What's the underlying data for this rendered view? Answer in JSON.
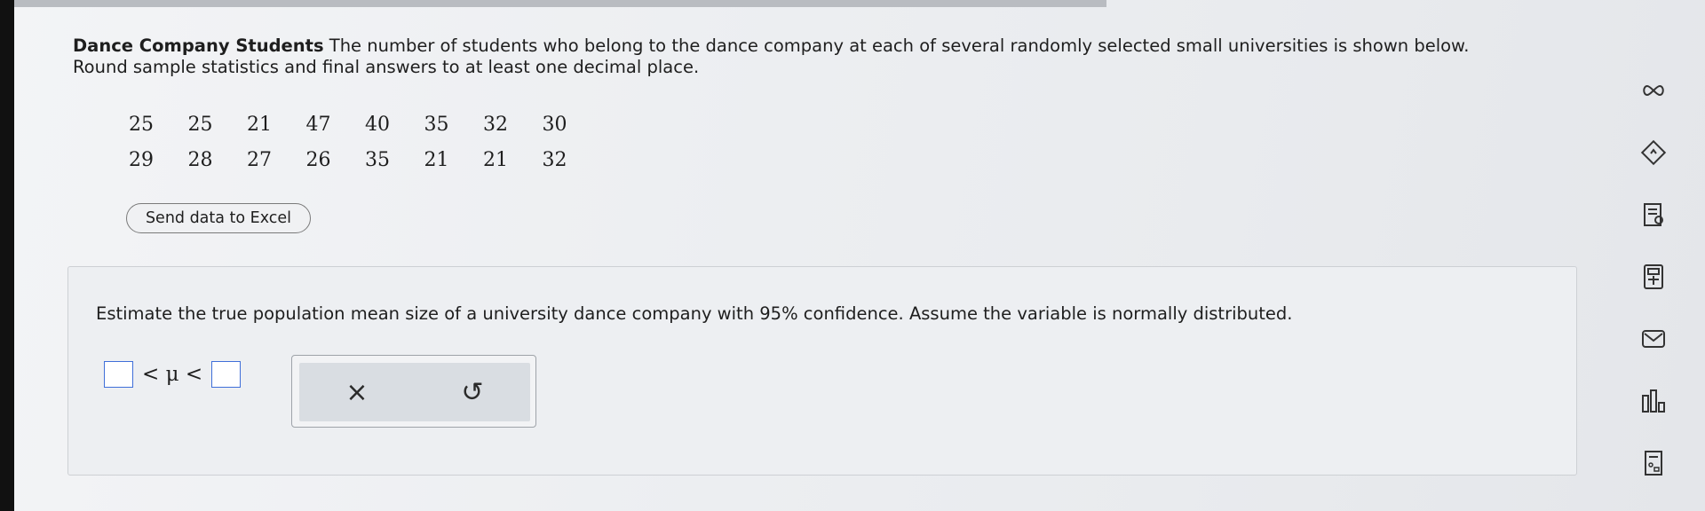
{
  "problem": {
    "title": "Dance Company Students",
    "text_line1": "The number of students who belong to the dance company at each of several randomly selected small universities is shown below.",
    "text_line2": "Round sample statistics and final answers to at least one decimal place."
  },
  "data_rows": [
    [
      "25",
      "25",
      "21",
      "47",
      "40",
      "35",
      "32",
      "30"
    ],
    [
      "29",
      "28",
      "27",
      "26",
      "35",
      "21",
      "21",
      "32"
    ]
  ],
  "excel_button_label": "Send data to Excel",
  "question": "Estimate the true population mean size of a university dance company with 95% confidence. Assume the variable is normally distributed.",
  "inequality": {
    "less_than": "<",
    "mu": "μ"
  },
  "tools": {
    "clear_glyph": "×",
    "undo_glyph": "↺"
  },
  "sidebar_icons": [
    "infinity-icon",
    "hint-icon",
    "textbook-icon",
    "calculator-icon",
    "message-icon",
    "chart-icon",
    "formula-sheet-icon"
  ],
  "colors": {
    "input_border": "#3f6fd9"
  }
}
